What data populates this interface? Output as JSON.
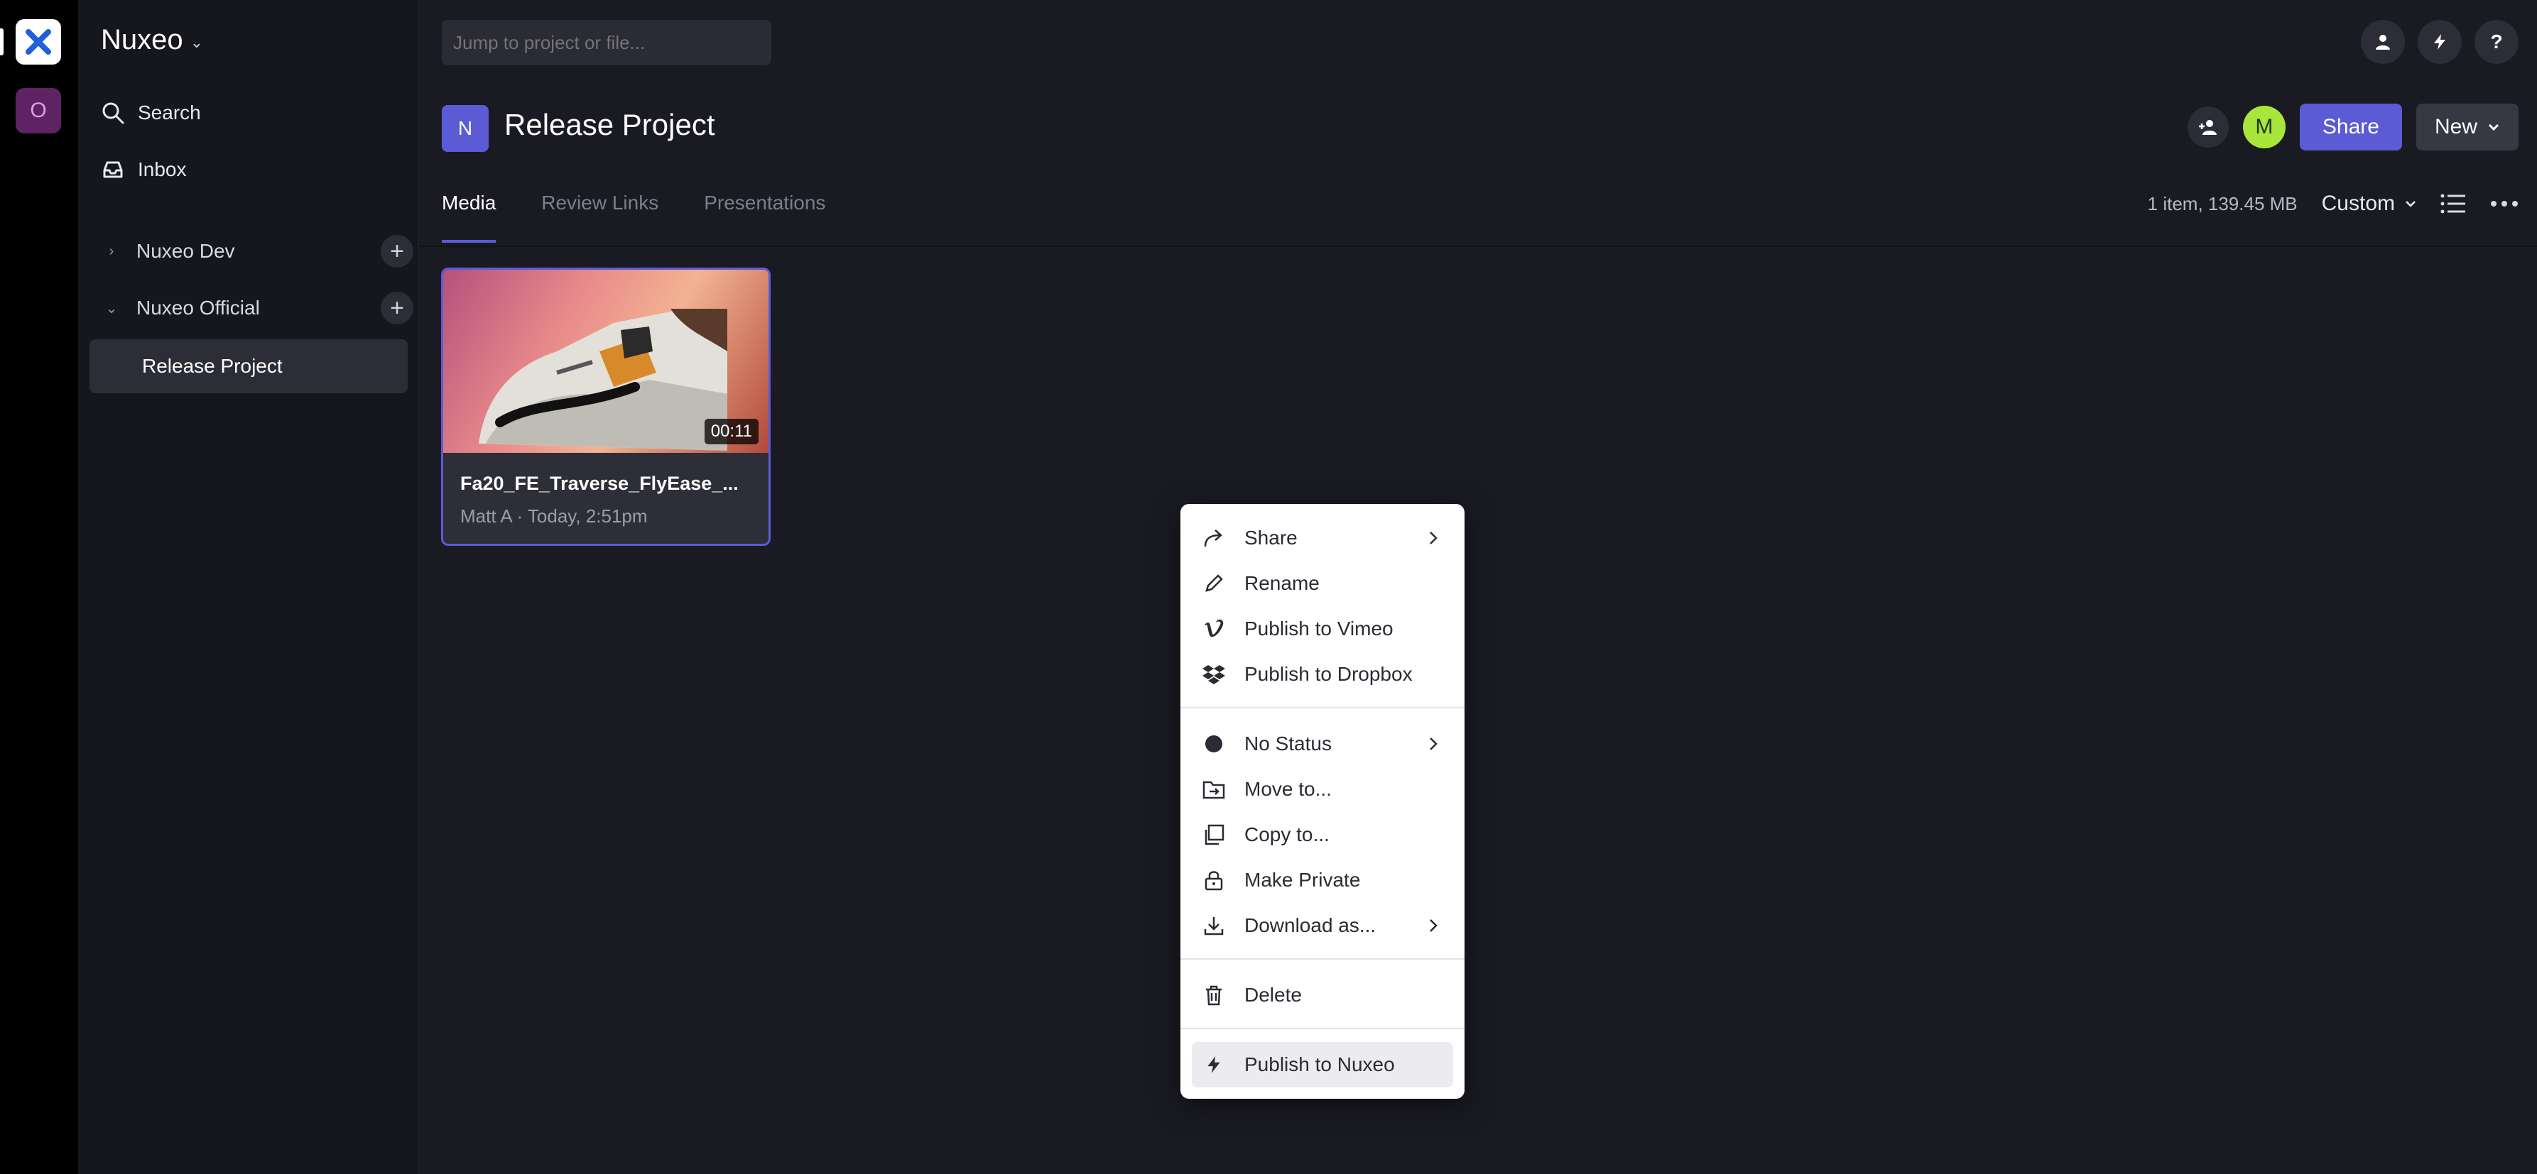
{
  "sidebar": {
    "team_name": "Nuxeo",
    "workspace_initial": "O",
    "nav": {
      "search": "Search",
      "inbox": "Inbox"
    },
    "projects": [
      {
        "label": "Nuxeo Dev"
      },
      {
        "label": "Nuxeo Official"
      }
    ],
    "active_project": "Release Project"
  },
  "top": {
    "search_placeholder": "Jump to project or file..."
  },
  "header": {
    "badge": "N",
    "title": "Release Project",
    "avatar_initial": "M",
    "share_label": "Share",
    "new_label": "New"
  },
  "tabs": [
    {
      "label": "Media"
    },
    {
      "label": "Review Links"
    },
    {
      "label": "Presentations"
    }
  ],
  "toolbar": {
    "item_count": "1 item, 139.45 MB",
    "sort_label": "Custom"
  },
  "asset": {
    "title": "Fa20_FE_Traverse_FlyEase_...",
    "subtitle": "Matt A · Today, 2:51pm",
    "duration": "00:11"
  },
  "context_menu": {
    "share": "Share",
    "rename": "Rename",
    "publish_vimeo": "Publish to Vimeo",
    "publish_dropbox": "Publish to Dropbox",
    "status": "No Status",
    "move": "Move to...",
    "copy": "Copy to...",
    "private": "Make Private",
    "download": "Download as...",
    "delete": "Delete",
    "publish_nuxeo": "Publish to Nuxeo"
  },
  "colors": {
    "accent": "#5b5bd6",
    "avatar": "#a8e63c",
    "workspace": "#5e2363"
  }
}
